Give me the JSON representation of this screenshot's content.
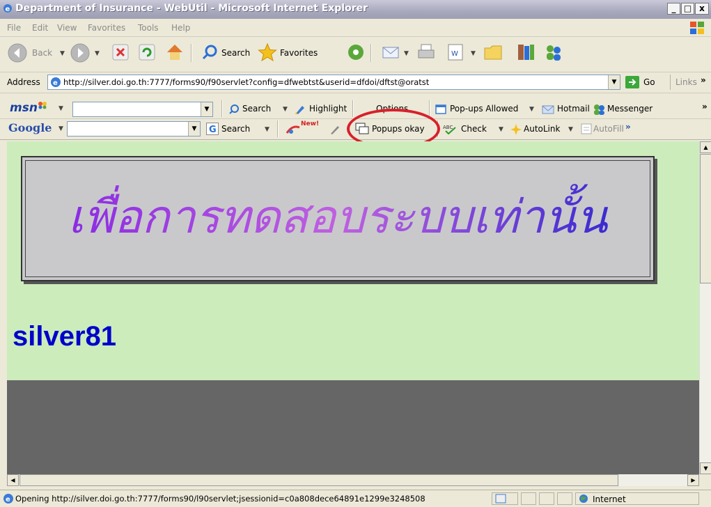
{
  "window": {
    "title": "Department of Insurance - WebUtil - Microsoft Internet Explorer",
    "minimize": "_",
    "maximize": "□",
    "close": "x"
  },
  "menu": [
    "File",
    "Edit",
    "View",
    "Favorites",
    "Tools",
    "Help"
  ],
  "toolbar": {
    "back": "Back",
    "search": "Search",
    "favorites": "Favorites"
  },
  "address": {
    "label": "Address",
    "url": "http://silver.doi.go.th:7777/forms90/f90servlet?config=dfwebtst&userid=dfdoi/dftst@oratst",
    "go": "Go",
    "links": "Links"
  },
  "msn": {
    "logo": "msn",
    "search": "Search",
    "highlight": "Highlight",
    "options": "Options",
    "popups": "Pop-ups Allowed",
    "hotmail": "Hotmail",
    "messenger": "Messenger"
  },
  "google": {
    "logo": "Google",
    "search": "Search",
    "new_badge": "New!",
    "popups": "Popups okay",
    "check": "Check",
    "autolink": "AutoLink",
    "autofill": "AutoFill"
  },
  "content": {
    "banner_text": "เพื่อการทดสอบระบบเท่านั้น",
    "server_name": "silver81"
  },
  "status": {
    "text": "Opening http://silver.doi.go.th:7777/forms90/l90servlet;jsessionid=c0a808dece64891e1299e3248508",
    "zone": "Internet"
  },
  "colors": {
    "content_bg": "#ccecbc",
    "server_text": "#0000cc",
    "highlight_circle": "#d8202a"
  }
}
